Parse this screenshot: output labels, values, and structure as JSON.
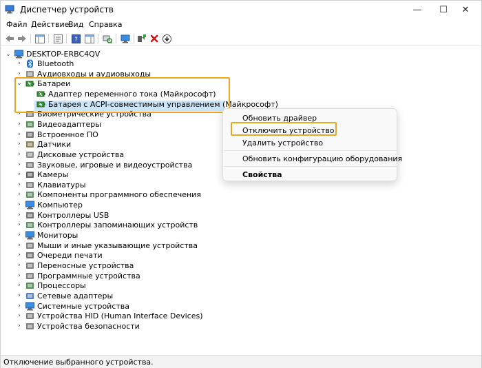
{
  "window": {
    "title": "Диспетчер устройств",
    "min": "—",
    "max": "☐",
    "close": "✕"
  },
  "menu": [
    "Файл",
    "Действие",
    "Вид",
    "Справка"
  ],
  "tree": {
    "root": "DESKTOP-ERBC4QV",
    "categories": [
      {
        "label": "Bluetooth",
        "icon": "bluetooth-icon"
      },
      {
        "label": "Аудиовходы и аудиовыходы",
        "icon": "audio-icon"
      },
      {
        "label": "Батареи",
        "icon": "battery-icon"
      },
      {
        "label": "Адаптер переменного тока (Майкрософт)",
        "icon": "battery-icon"
      },
      {
        "label": "Батарея с ACPI-совместимым управлением (Майкрософт)",
        "icon": "battery-icon"
      },
      {
        "label": "Биометрические устройства",
        "icon": "biometric-icon"
      },
      {
        "label": "Видеоадаптеры",
        "icon": "display-adapter-icon"
      },
      {
        "label": "Встроенное ПО",
        "icon": "firmware-icon"
      },
      {
        "label": "Датчики",
        "icon": "sensor-icon"
      },
      {
        "label": "Дисковые устройства",
        "icon": "disk-icon"
      },
      {
        "label": "Звуковые, игровые и видеоустройства",
        "icon": "sound-icon"
      },
      {
        "label": "Камеры",
        "icon": "camera-icon"
      },
      {
        "label": "Клавиатуры",
        "icon": "keyboard-icon"
      },
      {
        "label": "Компоненты программного обеспечения",
        "icon": "software-component-icon"
      },
      {
        "label": "Компьютер",
        "icon": "computer-icon"
      },
      {
        "label": "Контроллеры USB",
        "icon": "usb-icon"
      },
      {
        "label": "Контроллеры запоминающих устройств",
        "icon": "storage-controller-icon"
      },
      {
        "label": "Мониторы",
        "icon": "monitor-icon"
      },
      {
        "label": "Мыши и иные указывающие устройства",
        "icon": "mouse-icon"
      },
      {
        "label": "Очереди печати",
        "icon": "printer-icon"
      },
      {
        "label": "Переносные устройства",
        "icon": "portable-device-icon"
      },
      {
        "label": "Программные устройства",
        "icon": "software-device-icon"
      },
      {
        "label": "Процессоры",
        "icon": "processor-icon"
      },
      {
        "label": "Сетевые адаптеры",
        "icon": "network-adapter-icon"
      },
      {
        "label": "Системные устройства",
        "icon": "system-device-icon"
      },
      {
        "label": "Устройства HID (Human Interface Devices)",
        "icon": "hid-icon"
      },
      {
        "label": "Устройства безопасности",
        "icon": "security-device-icon"
      }
    ]
  },
  "context_menu": {
    "update_driver": "Обновить драйвер",
    "disable_device": "Отключить устройство",
    "uninstall_device": "Удалить устройство",
    "scan_hardware": "Обновить конфигурацию оборудования",
    "properties": "Свойства"
  },
  "status": {
    "text": "Отключение выбранного устройства."
  },
  "colors": {
    "highlight": "#e8a820",
    "selection": "#cce4f7"
  }
}
